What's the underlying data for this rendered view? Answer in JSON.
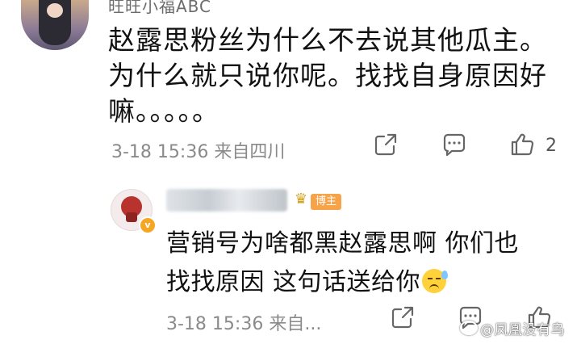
{
  "comment1": {
    "username_partial": "旺旺小福ABC",
    "text_lines": [
      "赵露思粉丝为什么不去说其他瓜主。",
      "为什么就只说你呢。找找自身原因好",
      "嘛。。。。。"
    ],
    "timestamp": "3-18 15:36",
    "location": "来自四川",
    "like_count": "2",
    "share_icon": "share-icon",
    "comment_icon": "comment-icon",
    "like_icon": "thumbs-up-icon"
  },
  "reply": {
    "badge_label": "博主",
    "verified_mark": "v",
    "text_lines": [
      "营销号为啥都黑赵露思啊  你们也",
      "找找原因  这句话送给你"
    ],
    "emoji_icon": "sweat-smile-emoji",
    "timestamp": "3-18 15:36",
    "location": "来自...",
    "share_icon": "share-icon",
    "comment_icon": "comment-icon",
    "like_icon": "thumbs-up-icon"
  },
  "watermark": {
    "text": "@凤凰没有鸟"
  },
  "colors": {
    "meta_gray": "#8a8a8a",
    "badge_orange": "#f6a34a",
    "vip_gold": "#f5a623"
  }
}
